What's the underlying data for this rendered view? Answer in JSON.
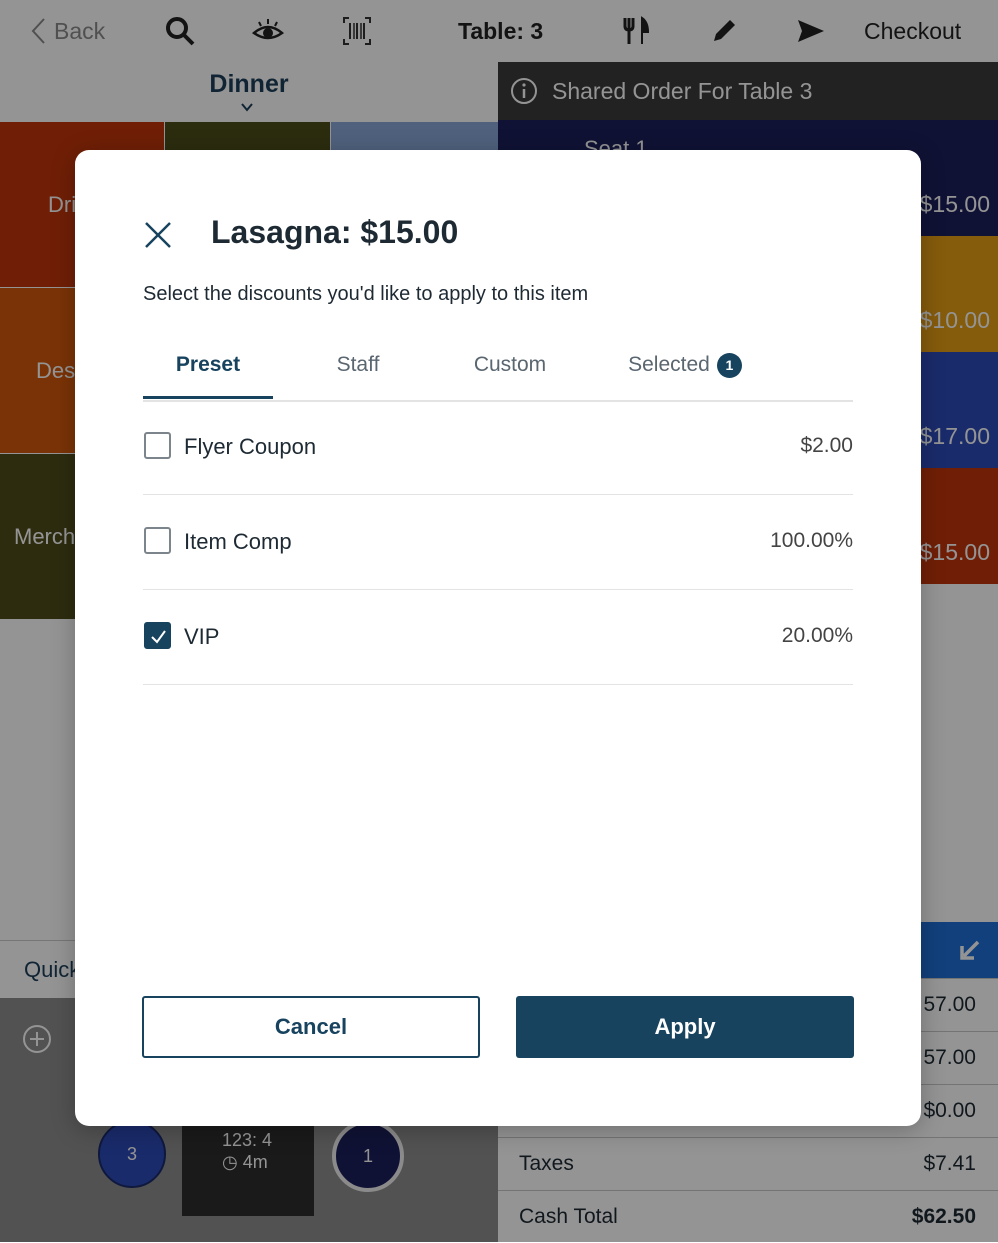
{
  "topbar": {
    "back_label": "Back",
    "table_label": "Table: 3",
    "checkout_label": "Checkout",
    "icons": [
      "chevron-left-icon",
      "search-icon",
      "eye-icon",
      "barcode-icon",
      "utensils-icon",
      "pencil-icon",
      "send-icon"
    ]
  },
  "menu": {
    "title": "Dinner",
    "tiles": [
      "Dri",
      "Des",
      "Merch"
    ],
    "quick_label": "Quick"
  },
  "order": {
    "shared_title": "Shared Order For Table 3",
    "seat_label": "Seat 1",
    "prices": [
      "$15.00",
      "$10.00",
      "$17.00",
      "$15.00"
    ]
  },
  "totals": {
    "values": [
      "57.00",
      "57.00",
      "$0.00"
    ],
    "taxes_label": "Taxes",
    "taxes_value": "$7.41",
    "cash_total_label": "Cash Total",
    "cash_total_value": "$62.50"
  },
  "table_area": {
    "seat_left": "3",
    "seat_right": "1",
    "table_line1": "123: 4",
    "table_line2": "4m"
  },
  "modal": {
    "title": "Lasagna: $15.00",
    "subtitle": "Select the discounts you'd like to apply to this item",
    "tabs": [
      {
        "label": "Preset",
        "active": true
      },
      {
        "label": "Staff",
        "active": false
      },
      {
        "label": "Custom",
        "active": false
      },
      {
        "label": "Selected",
        "active": false,
        "count": "1"
      }
    ],
    "discounts": [
      {
        "name": "Flyer Coupon",
        "value": "$2.00",
        "checked": false
      },
      {
        "name": "Item Comp",
        "value": "100.00%",
        "checked": false
      },
      {
        "name": "VIP",
        "value": "20.00%",
        "checked": true
      }
    ],
    "cancel_label": "Cancel",
    "apply_label": "Apply"
  },
  "colors": {
    "accent": "#17435f",
    "seat_bar": "#1c1f5c",
    "shared_bar": "#3b3b3b",
    "tile_drinks": "#c2360b",
    "tile_desserts": "#d2590b",
    "tile_merch": "#4f4c1a",
    "tile_olive": "#4c4c1a",
    "tile_blue": "#88a7d8"
  }
}
